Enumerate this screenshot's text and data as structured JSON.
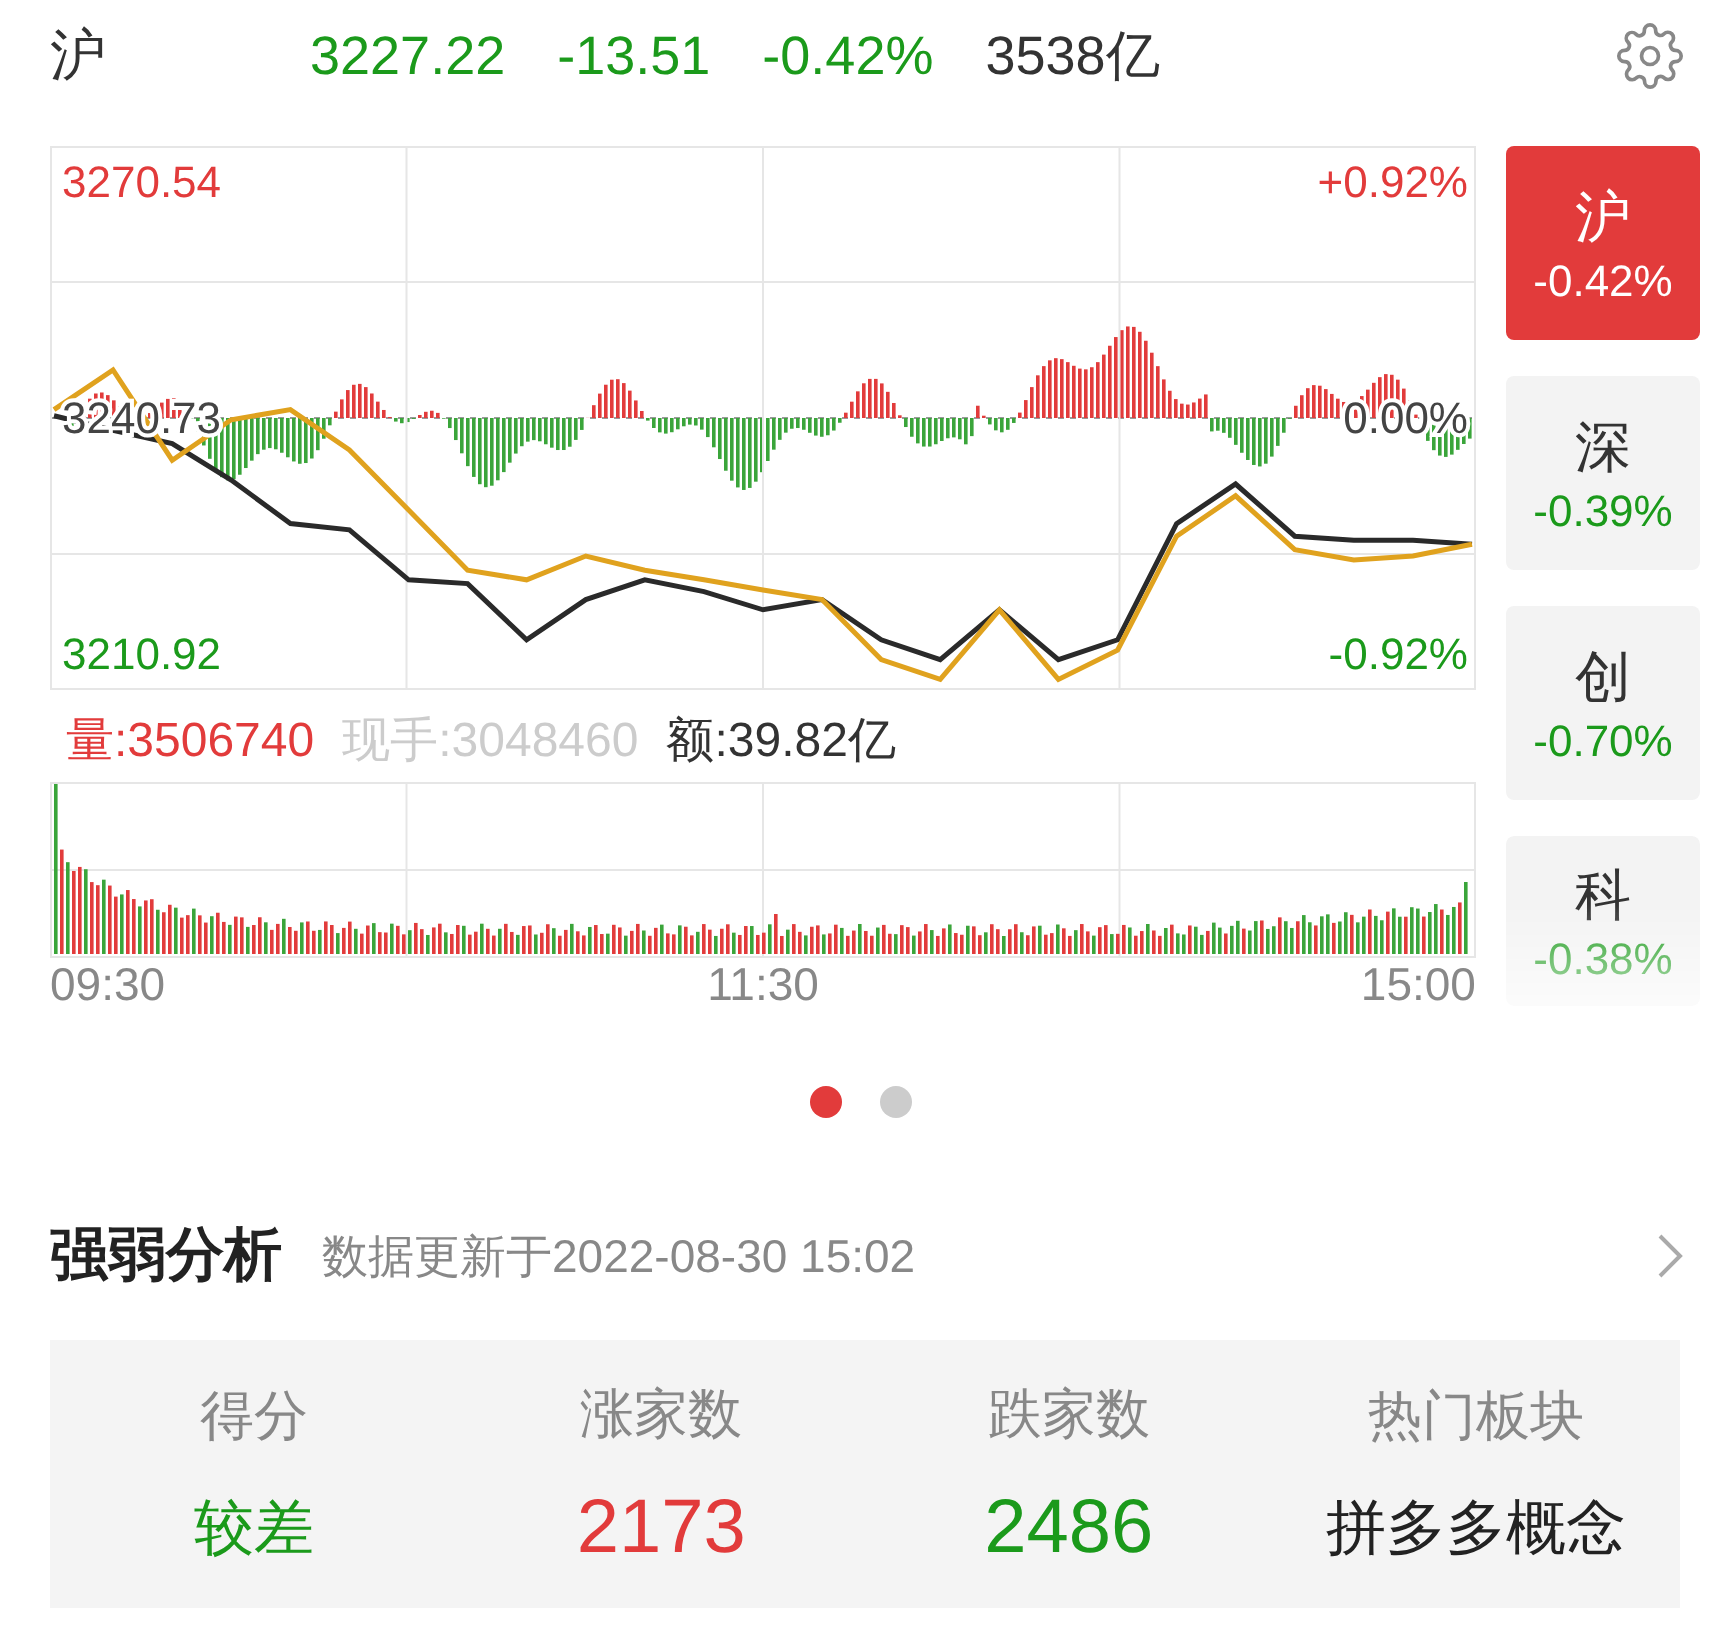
{
  "header": {
    "market": "沪",
    "price": "3227.22",
    "change": "-13.51",
    "percent": "-0.42%",
    "turnover": "3538亿"
  },
  "price_chart": {
    "right_labels": [
      "+0.92%",
      "0.00%",
      "-0.92%"
    ],
    "chart_data": {
      "type": "line",
      "grid": true,
      "ylim": [
        3206.37,
        3275.09
      ],
      "yticks": [
        {
          "value": 3270.54,
          "label": "3270.54"
        },
        {
          "value": 3240.73,
          "label": "3240.73"
        },
        {
          "value": 3210.92,
          "label": "3210.92"
        }
      ],
      "series": [
        {
          "color": "#2a2a2a",
          "values": [
            3241.0,
            3239.2,
            3237.5,
            3232.9,
            3227.4,
            3226.6,
            3220.3,
            3219.8,
            3212.7,
            3217.8,
            3220.3,
            3218.8,
            3216.5,
            3217.8,
            3212.7,
            3210.2,
            3216.5,
            3210.2,
            3212.7,
            3227.4,
            3232.4,
            3225.8,
            3225.3,
            3225.3,
            3224.8
          ]
        },
        {
          "color": "#e0a21e",
          "values": [
            3241.8,
            3246.8,
            3235.4,
            3240.5,
            3241.8,
            3236.7,
            3229.1,
            3221.5,
            3220.3,
            3223.3,
            3221.5,
            3220.3,
            3219.0,
            3217.8,
            3210.2,
            3207.7,
            3216.5,
            3207.7,
            3211.4,
            3225.8,
            3230.9,
            3224.1,
            3222.8,
            3223.3,
            3224.8
          ]
        }
      ]
    }
  },
  "volume": {
    "volume": "量:3506740",
    "current": "现手:3048460",
    "amount": "额:39.82亿"
  },
  "time_labels": [
    "09:30",
    "11:30",
    "15:00"
  ],
  "index_cards": [
    {
      "name": "沪",
      "change": "-0.42%",
      "selected": true
    },
    {
      "name": "深",
      "change": "-0.39%",
      "selected": false
    },
    {
      "name": "创",
      "change": "-0.70%",
      "selected": false
    },
    {
      "name": "科",
      "change": "-0.38%",
      "selected": false
    }
  ],
  "pager": [
    {
      "selected": true
    },
    {
      "selected": false
    }
  ],
  "analysis": {
    "title": "强弱分析",
    "updated": "数据更新于2022-08-30 15:02",
    "stats": [
      {
        "label": "得分",
        "value": "较差",
        "kind": "fall"
      },
      {
        "label": "涨家数",
        "value": "2173",
        "kind": "rise"
      },
      {
        "label": "跌家数",
        "value": "2486",
        "kind": "fall"
      },
      {
        "label": "热门板块",
        "value": "拼多多概念",
        "kind": "text"
      }
    ]
  }
}
